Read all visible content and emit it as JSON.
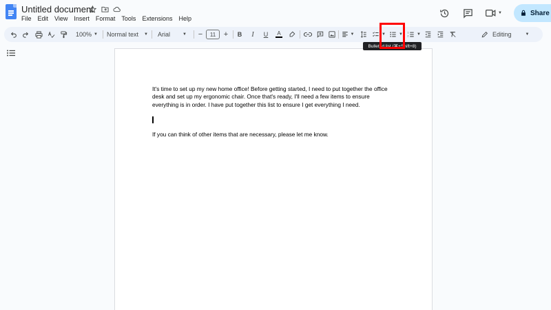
{
  "doc": {
    "title": "Untitled document"
  },
  "menu": [
    "File",
    "Edit",
    "View",
    "Insert",
    "Format",
    "Tools",
    "Extensions",
    "Help"
  ],
  "header": {
    "share_label": "Share"
  },
  "toolbar": {
    "zoom": "100%",
    "style": "Normal text",
    "font": "Arial",
    "font_size": "11",
    "mode": "Editing",
    "tooltip": "Bulleted list (⌘+Shift+8)"
  },
  "document": {
    "paragraph1": "It's time to set up my new home office! Before getting started, I need to put together the office desk and set up my ergonomic chair. Once that's ready, I'll need a few items to ensure everything is in order. I have put together this list to ensure I get everything I need.",
    "paragraph2": "If you can think of other items that are necessary, please let me know."
  },
  "colors": {
    "brand_blue": "#4285f4",
    "share_bg": "#c2e7ff",
    "toolbar_bg": "#edf2fa",
    "highlight": "#ff0000"
  }
}
